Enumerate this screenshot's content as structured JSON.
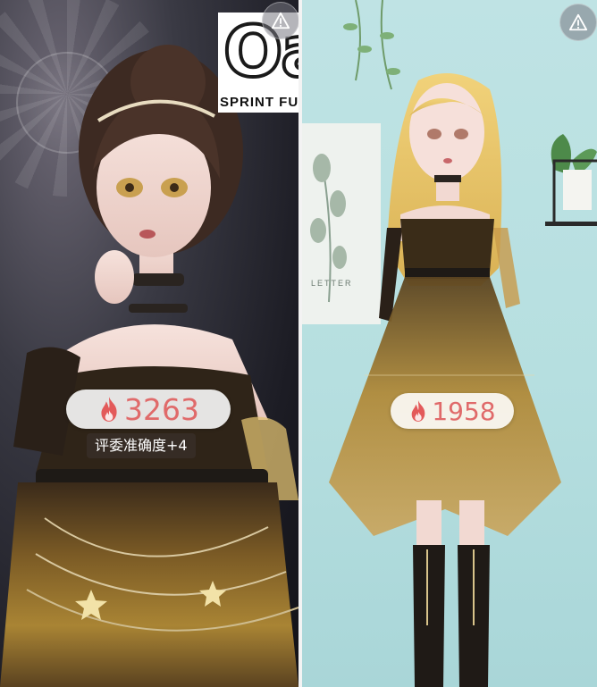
{
  "left_panel": {
    "event_logo": {
      "mark": "Oa",
      "subtitle": "SPRINT FU"
    },
    "score": "3263",
    "judge_bonus": "评委准确度+4",
    "warn_icon": "warning-triangle-icon"
  },
  "right_panel": {
    "score": "1958",
    "poster_text": "LETTER",
    "warn_icon": "warning-triangle-icon"
  },
  "colors": {
    "score_text": "#e06a6a",
    "flame": "#e35a5a",
    "gold_dress": "#b8922f",
    "left_bg": "#1c1c24",
    "right_bg": "#b6dfe0"
  }
}
